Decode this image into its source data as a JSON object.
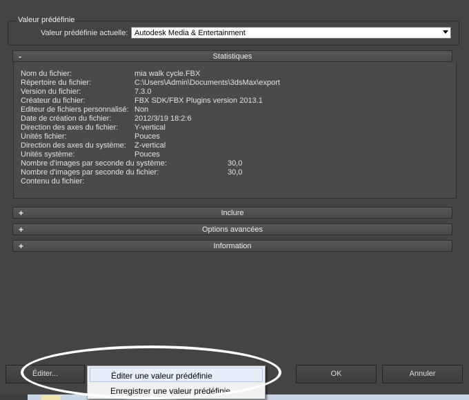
{
  "preset": {
    "group_title": "Valeur prédéfinie",
    "current_label": "Valeur prédéfinie actuelle:",
    "current_value": "Autodesk Media & Entertainment"
  },
  "rollouts": {
    "statistics": {
      "toggle": "-",
      "title": "Statistiques"
    },
    "include": {
      "toggle": "+",
      "title": "Inclure"
    },
    "advanced": {
      "toggle": "+",
      "title": "Options avancées"
    },
    "information": {
      "toggle": "+",
      "title": "Information"
    }
  },
  "stats": [
    {
      "label": "Nom du fichier:",
      "value": "mia walk cycle.FBX"
    },
    {
      "label": "Répertoire du fichier:",
      "value": "C:\\Users\\Admin\\Documents\\3dsMax\\export"
    },
    {
      "label": "Version du fichier:",
      "value": "7.3.0"
    },
    {
      "label": "Créateur du fichier:",
      "value": "FBX SDK/FBX Plugins version 2013.1"
    },
    {
      "label": "Editeur de fichiers personnalisé:",
      "value": "Non"
    },
    {
      "label": "Date de création du fichier:",
      "value": "2012/3/19  18:2:6"
    },
    {
      "label": "Direction des axes du fichier:",
      "value": "Y-vertical"
    },
    {
      "label": "Unités fichier:",
      "value": "Pouces"
    },
    {
      "label": "Direction des axes du système:",
      "value": "Z-vertical"
    },
    {
      "label": "Unités système:",
      "value": "Pouces"
    },
    {
      "label": "Nombre d'images par seconde du système:",
      "value": "30,0"
    },
    {
      "label": "Nombre d'images par seconde du fichier:",
      "value": "30,0"
    },
    {
      "label": "Contenu du fichier:",
      "value": ""
    }
  ],
  "buttons": {
    "edit": "Éditer...",
    "ok": "OK",
    "cancel": "Annuler"
  },
  "menu": {
    "edit_preset": "Éditer une valeur prédéfinie",
    "save_preset": "Enregistrer une valeur prédéfinie"
  }
}
